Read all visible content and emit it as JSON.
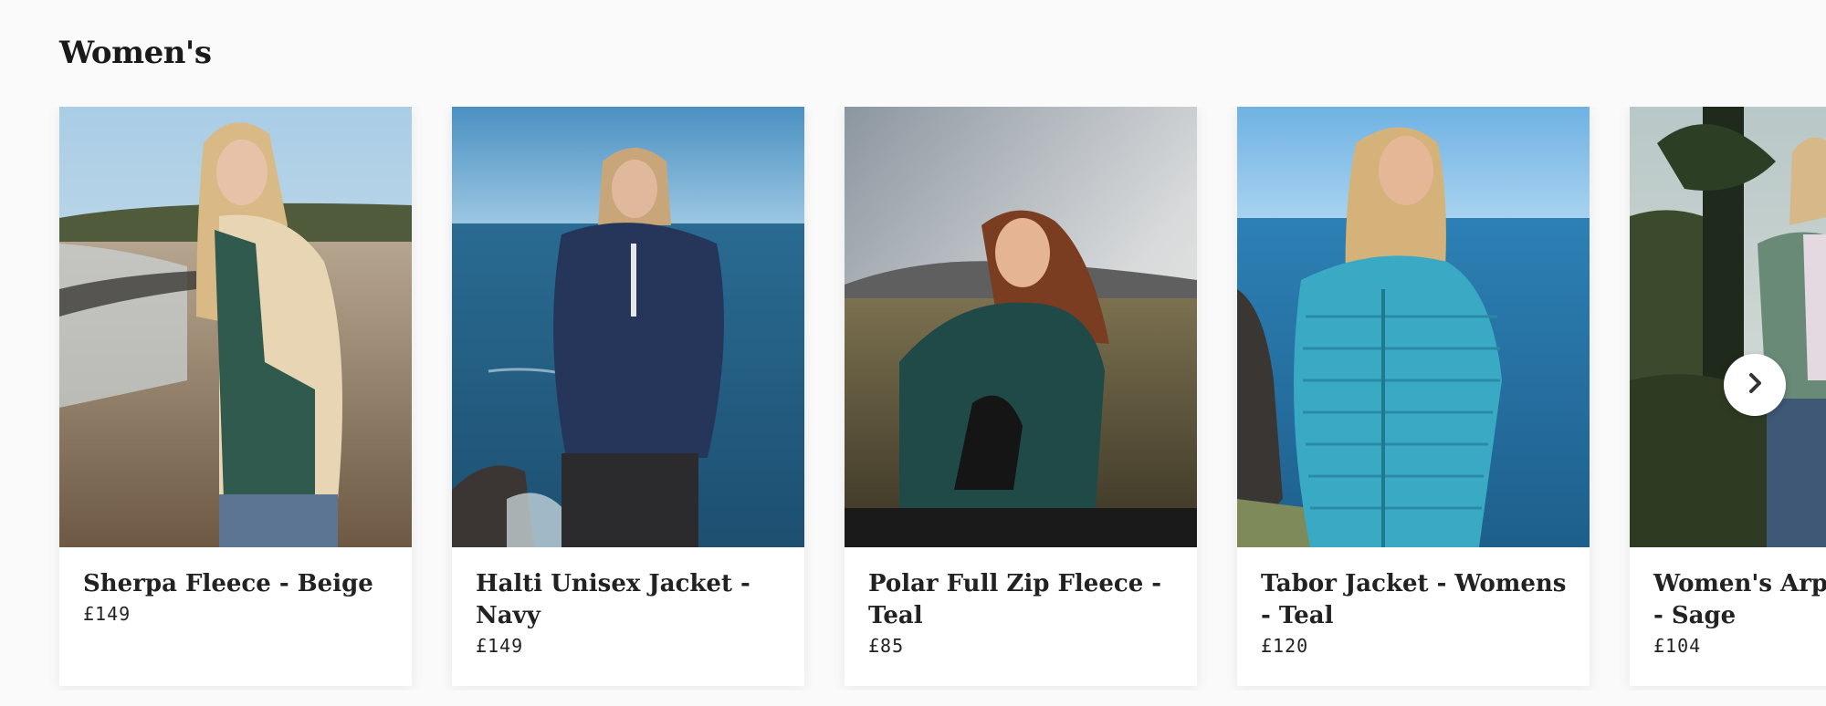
{
  "section": {
    "title": "Women's"
  },
  "products": [
    {
      "name": "Sherpa Fleece - Beige",
      "price": "£149"
    },
    {
      "name": "Halti Unisex Jacket - Navy",
      "price": "£149"
    },
    {
      "name": "Polar Full Zip Fleece - Teal",
      "price": "£85"
    },
    {
      "name": "Tabor Jacket - Womens - Teal",
      "price": "£120"
    },
    {
      "name": "Women's Arpeto Fleece - Sage",
      "price": "£104"
    }
  ],
  "carousel": {
    "next_icon": "chevron-right-icon"
  }
}
